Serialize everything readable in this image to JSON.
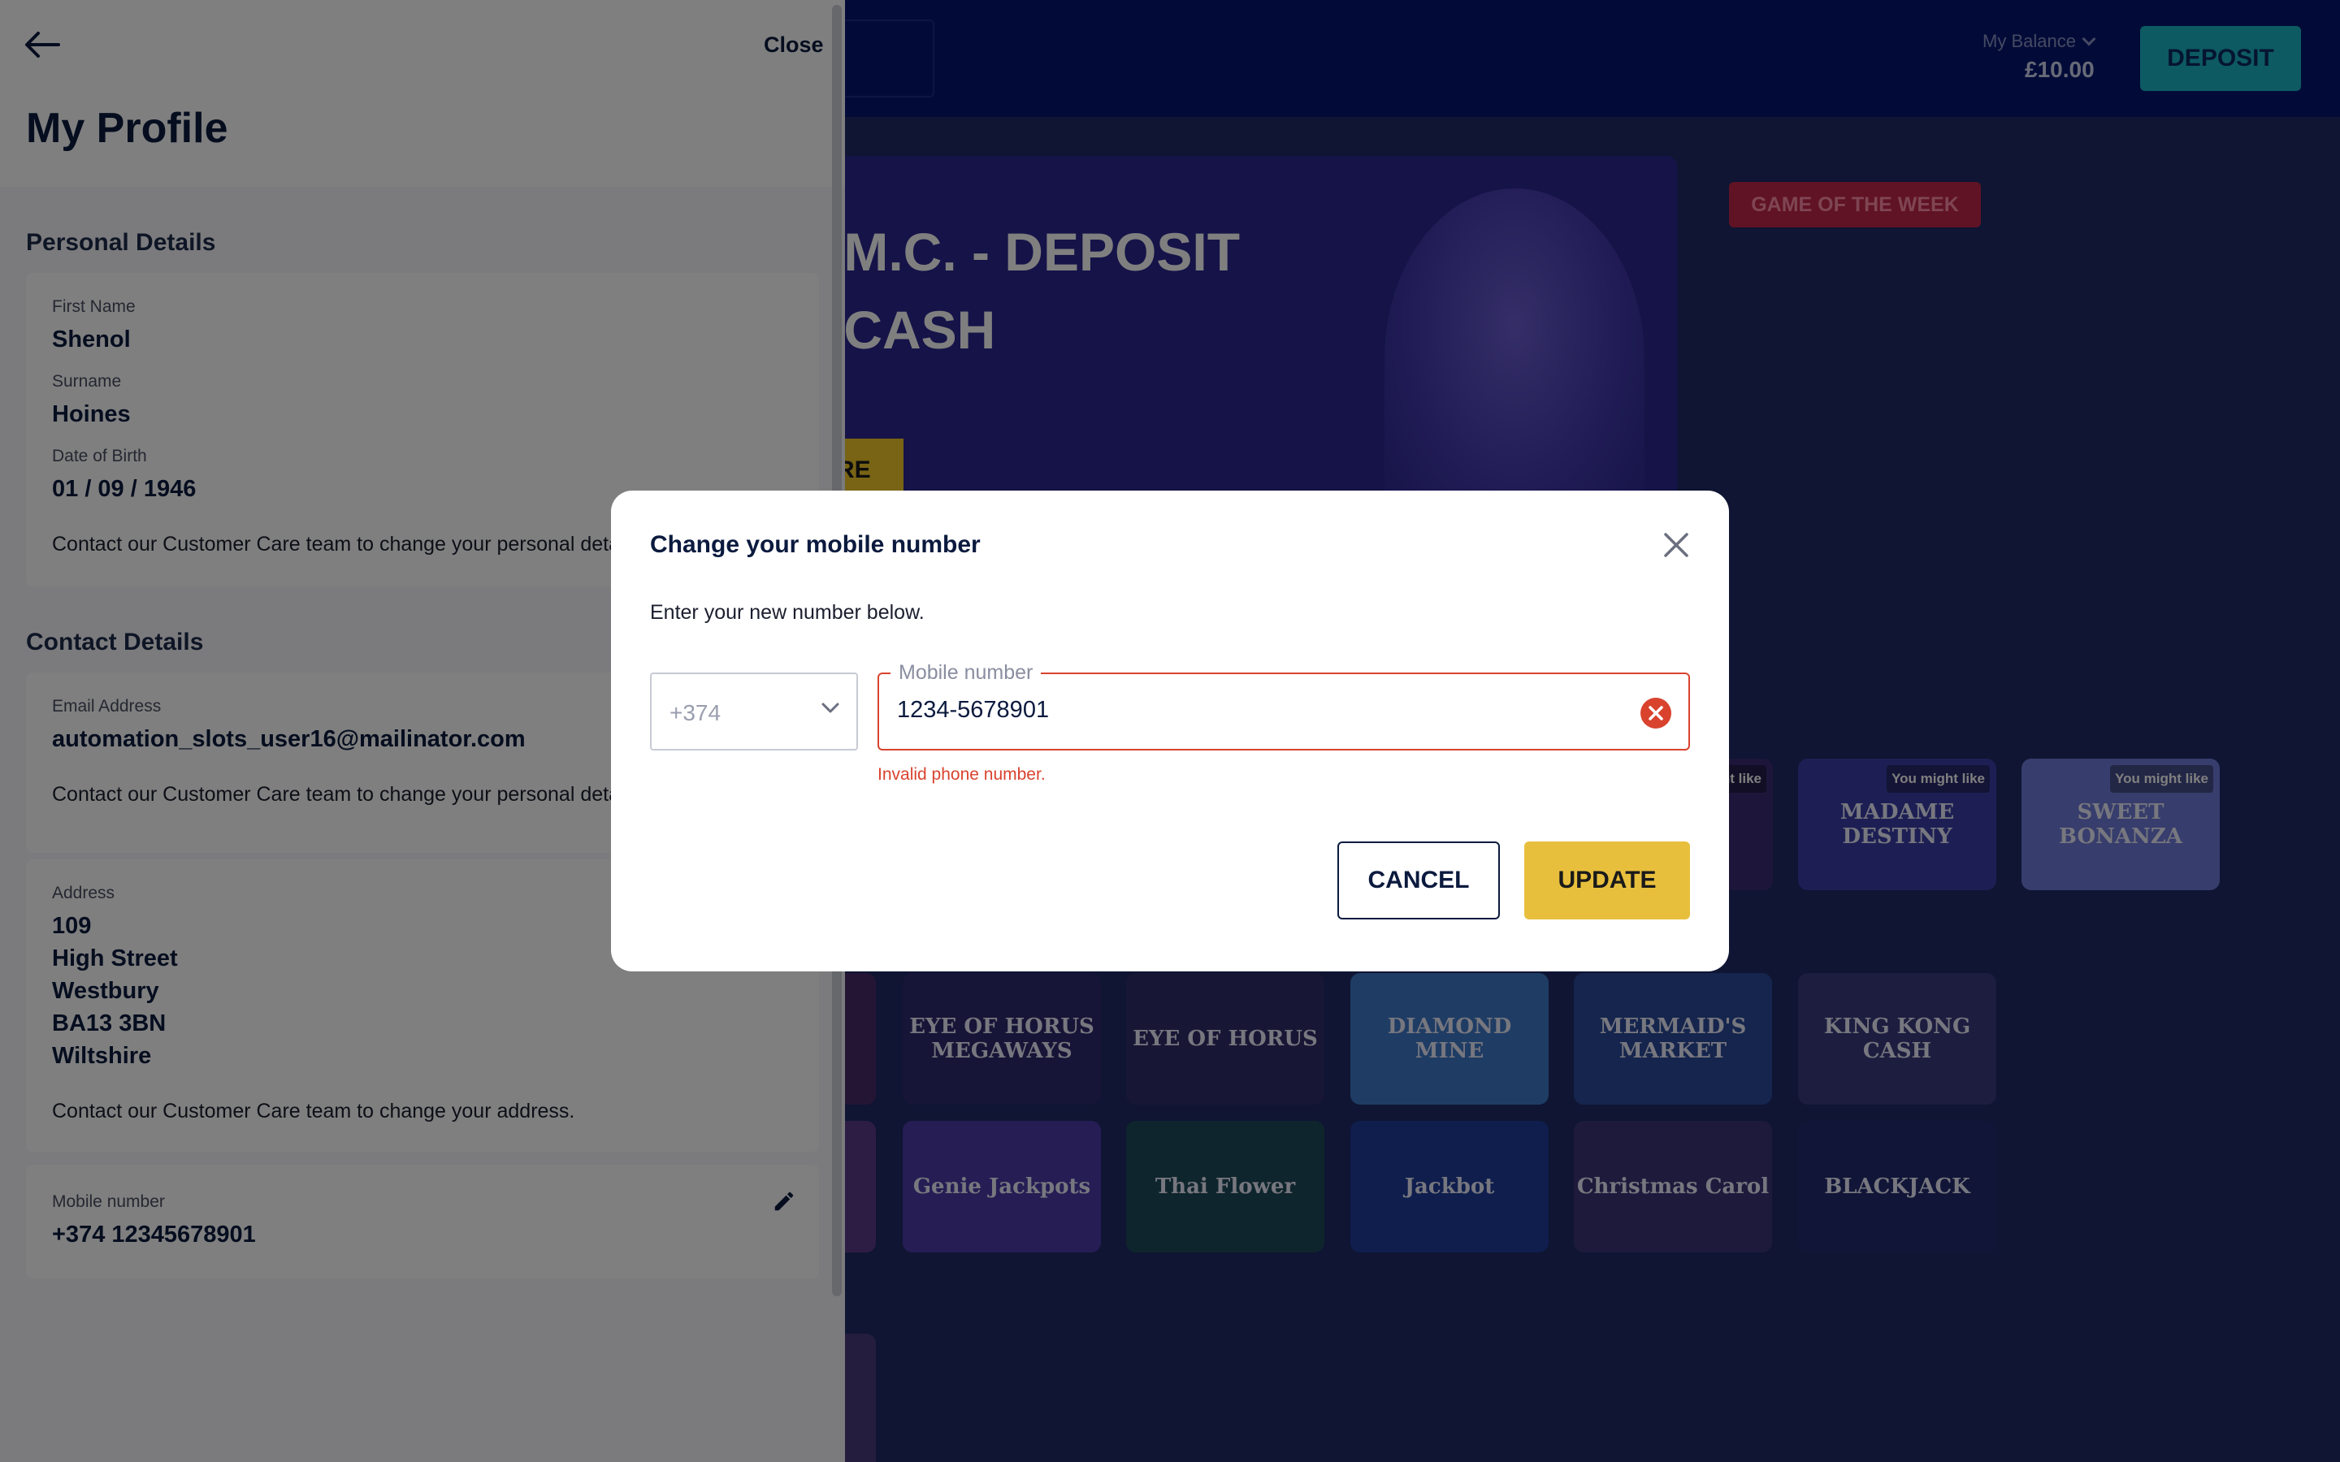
{
  "background": {
    "balance_label": "My Balance",
    "balance_value": "£10.00",
    "deposit_label": "DEPOSIT",
    "hero_title": ".M.C. - DEPOSIT\n CASH",
    "hero_button": "RE",
    "game_of_week": "GAME OF THE WEEK",
    "tiles": [
      {
        "title": "",
        "tag": "nt like"
      },
      {
        "title": "MADAME DESTINY",
        "tag": "You might like"
      },
      {
        "title": "SWEET BONANZA",
        "tag": "You might like"
      },
      {
        "title": "EYE OF HORUS MEGAWAYS"
      },
      {
        "title": "EYE OF HORUS"
      },
      {
        "title": "DIAMOND MINE"
      },
      {
        "title": "MERMAID'S MARKET"
      },
      {
        "title": "KING KONG CASH"
      },
      {
        "title": "Genie Jackpots"
      },
      {
        "title": "Thai Flower"
      },
      {
        "title": "Jackbot"
      },
      {
        "title": "Christmas Carol"
      },
      {
        "title": "BLACKJACK"
      }
    ]
  },
  "panel": {
    "close_label": "Close",
    "title": "My Profile",
    "personal": {
      "heading": "Personal Details",
      "first_name_label": "First Name",
      "first_name": "Shenol",
      "surname_label": "Surname",
      "surname": "Hoines",
      "dob_label": "Date of Birth",
      "dob": "01 / 09 / 1946",
      "note": "Contact our Customer Care team to change your personal details."
    },
    "contact": {
      "heading": "Contact Details",
      "email_label": "Email Address",
      "email": "automation_slots_user16@mailinator.com",
      "email_note": "Contact our Customer Care team to change your personal details.",
      "address_label": "Address",
      "address_lines": [
        "109",
        "High Street",
        "Westbury",
        "BA13 3BN",
        "Wiltshire"
      ],
      "address_note": "Contact our Customer Care team to change your address.",
      "mobile_label": "Mobile number",
      "mobile": "+374 12345678901"
    }
  },
  "modal": {
    "title": "Change your mobile number",
    "subtitle": "Enter your new number below.",
    "country_code": "+374",
    "mobile_label": "Mobile number",
    "mobile_value": "1234-5678901",
    "error": "Invalid phone number.",
    "cancel_label": "CANCEL",
    "update_label": "UPDATE"
  },
  "colors": {
    "error": "#d9432e",
    "update_button": "#e8bf3d",
    "deposit_button": "#1ab5c7",
    "header": "#041670"
  }
}
